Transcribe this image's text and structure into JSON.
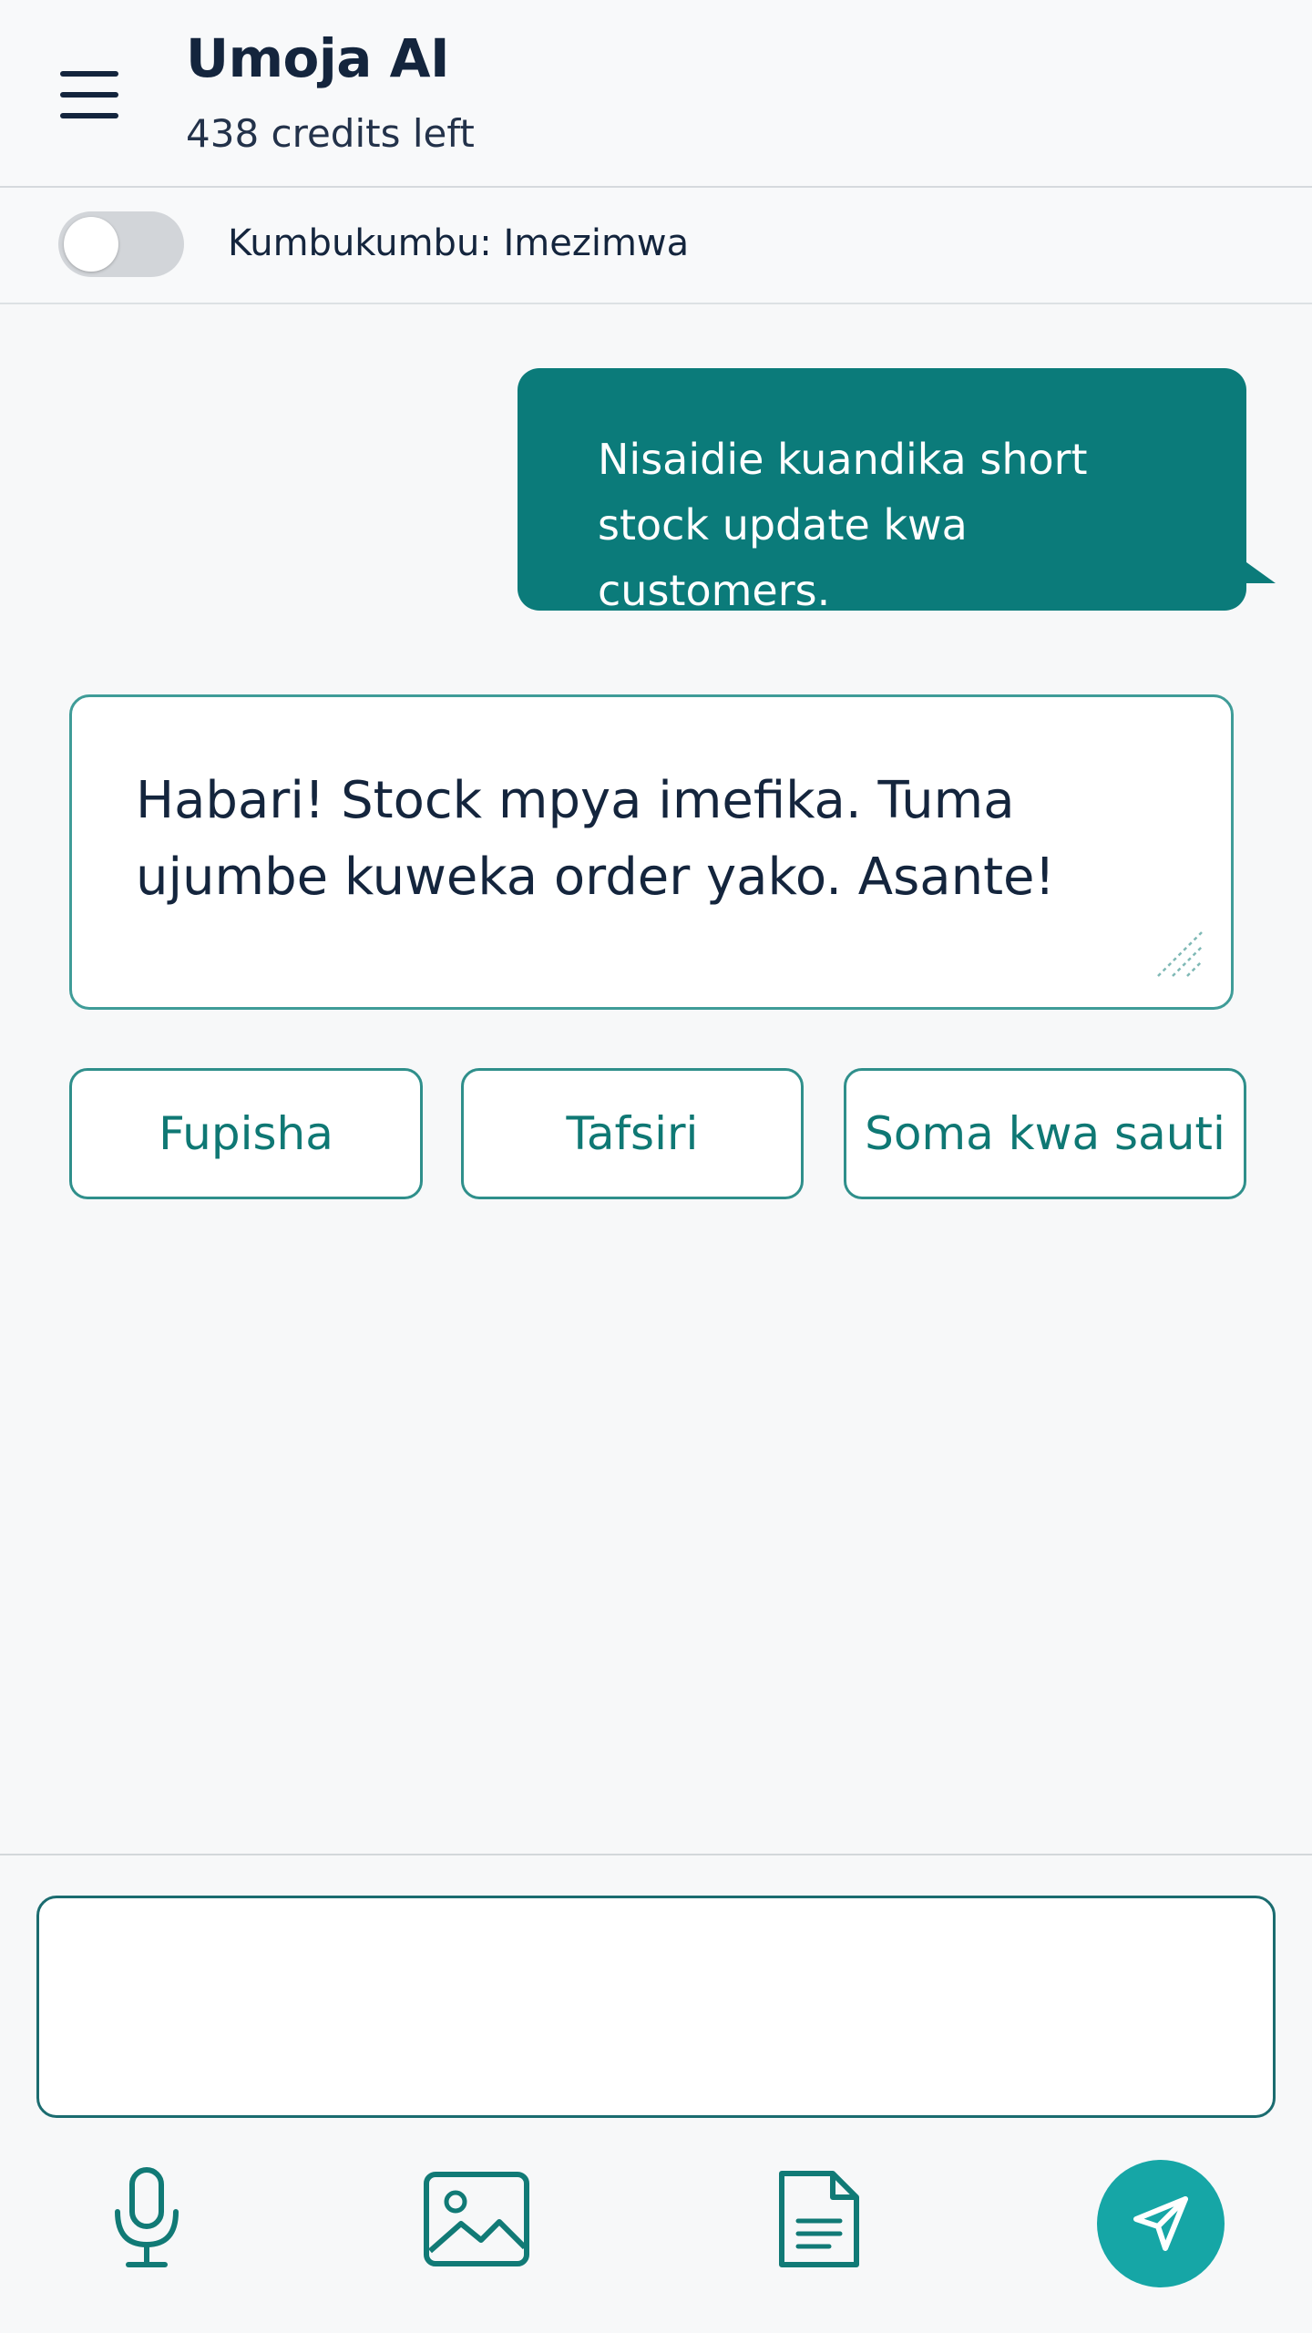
{
  "header": {
    "menu_icon": "hamburger-menu-icon",
    "title": "Umoja AI",
    "credits": "438 credits left"
  },
  "memory_toggle": {
    "label": "Kumbukumbu: Imezimwa",
    "enabled": false
  },
  "chat": {
    "messages": [
      {
        "role": "user",
        "lines": [
          "Nisaidie kuandika short",
          "stock update kwa customers."
        ]
      },
      {
        "role": "assistant",
        "lines": [
          "Habari! Stock mpya imefika. Tuma",
          "ujumbe kuweka order yako. Asante!"
        ]
      }
    ],
    "actions": [
      {
        "label": "Fupisha"
      },
      {
        "label": "Tafsiri"
      },
      {
        "label": "Soma kwa sauti"
      }
    ]
  },
  "composer": {
    "value": "",
    "placeholder": "",
    "tools": [
      {
        "icon": "microphone-icon"
      },
      {
        "icon": "image-icon"
      },
      {
        "icon": "document-icon"
      },
      {
        "icon": "send-icon"
      }
    ]
  },
  "colors": {
    "accent": "#0b7b7a",
    "accent_border": "#2f8f8b",
    "send_button": "#16a6a6",
    "text_primary": "#14253d",
    "background": "#f7f8f9",
    "toggle_off": "#d2d5d9"
  }
}
